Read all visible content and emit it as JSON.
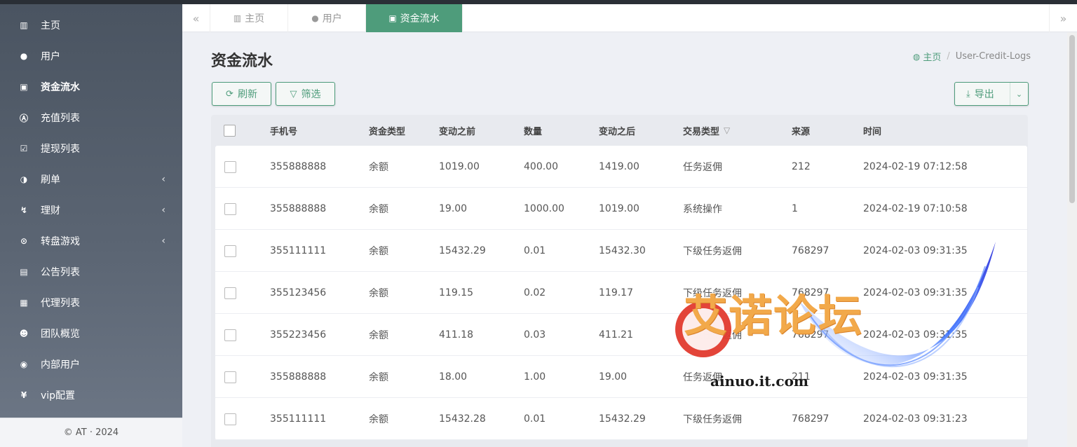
{
  "sidebar": {
    "items": [
      {
        "icon": "▥",
        "label": "主页",
        "has_sub": false,
        "active": false
      },
      {
        "icon": "●",
        "label": "用户",
        "has_sub": false,
        "active": false
      },
      {
        "icon": "▣",
        "label": "资金流水",
        "has_sub": false,
        "active": true
      },
      {
        "icon": "Ⓐ",
        "label": "充值列表",
        "has_sub": false,
        "active": false
      },
      {
        "icon": "☑",
        "label": "提现列表",
        "has_sub": false,
        "active": false
      },
      {
        "icon": "◑",
        "label": "刷单",
        "has_sub": true,
        "active": false
      },
      {
        "icon": "↯",
        "label": "理财",
        "has_sub": true,
        "active": false
      },
      {
        "icon": "⊙",
        "label": "转盘游戏",
        "has_sub": true,
        "active": false
      },
      {
        "icon": "▤",
        "label": "公告列表",
        "has_sub": false,
        "active": false
      },
      {
        "icon": "▦",
        "label": "代理列表",
        "has_sub": false,
        "active": false
      },
      {
        "icon": "☻",
        "label": "团队概览",
        "has_sub": false,
        "active": false
      },
      {
        "icon": "◉",
        "label": "内部用户",
        "has_sub": false,
        "active": false
      },
      {
        "icon": "¥",
        "label": "vip配置",
        "has_sub": false,
        "active": false
      }
    ],
    "caret": "‹",
    "footer": "© AT · 2024"
  },
  "tabs": {
    "prev": "«",
    "next": "»",
    "items": [
      {
        "icon": "▥",
        "label": "主页",
        "active": false
      },
      {
        "icon": "●",
        "label": "用户",
        "active": false
      },
      {
        "icon": "▣",
        "label": "资金流水",
        "active": true
      }
    ]
  },
  "page": {
    "title": "资金流水",
    "breadcrumb": {
      "home_icon": "◍",
      "home": "主页",
      "separator": "/",
      "current": "User-Credit-Logs"
    }
  },
  "toolbar": {
    "refresh_icon": "⟳",
    "refresh_label": "刷新",
    "filter_icon": "▽",
    "filter_label": "筛选",
    "export_icon": "⤓",
    "export_label": "导出",
    "export_caret": "⌄"
  },
  "table": {
    "filter_icon": "▽",
    "columns": [
      "手机号",
      "资金类型",
      "变动之前",
      "数量",
      "变动之后",
      "交易类型",
      "来源",
      "时间"
    ],
    "rows": [
      [
        "355888888",
        "余额",
        "1019.00",
        "400.00",
        "1419.00",
        "任务返佣",
        "212",
        "2024-02-19 07:12:58"
      ],
      [
        "355888888",
        "余额",
        "19.00",
        "1000.00",
        "1019.00",
        "系统操作",
        "1",
        "2024-02-19 07:10:58"
      ],
      [
        "355111111",
        "余额",
        "15432.29",
        "0.01",
        "15432.30",
        "下级任务返佣",
        "768297",
        "2024-02-03 09:31:35"
      ],
      [
        "355123456",
        "余额",
        "119.15",
        "0.02",
        "119.17",
        "下级任务返佣",
        "768297",
        "2024-02-03 09:31:35"
      ],
      [
        "355223456",
        "余额",
        "411.18",
        "0.03",
        "411.21",
        "下级任务返佣",
        "768297",
        "2024-02-03 09:31:35"
      ],
      [
        "355888888",
        "余额",
        "18.00",
        "1.00",
        "19.00",
        "任务返佣",
        "211",
        "2024-02-03 09:31:35"
      ],
      [
        "355111111",
        "余额",
        "15432.28",
        "0.01",
        "15432.29",
        "下级任务返佣",
        "768297",
        "2024-02-03 09:31:23"
      ]
    ]
  },
  "watermark": {
    "title": "艾诺论坛",
    "url": "ainuo.it.com"
  },
  "colors": {
    "accent": "#4e9c7b",
    "sidebar": "#4a5461",
    "background": "#eef0f5"
  }
}
